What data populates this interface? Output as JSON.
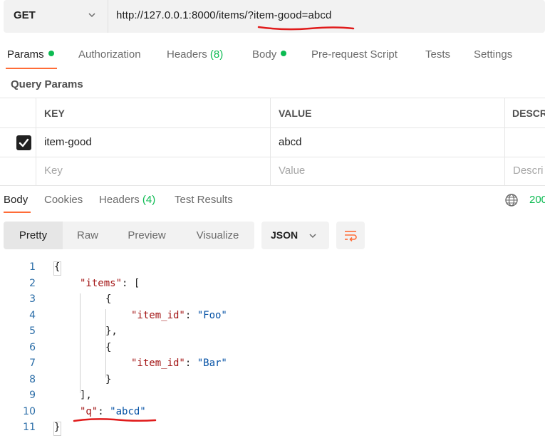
{
  "request": {
    "method": "GET",
    "url": "http://127.0.0.1:8000/items/?item-good=abcd"
  },
  "request_tabs": {
    "params": "Params",
    "authorization": "Authorization",
    "headers": "Headers",
    "headers_count": "(8)",
    "body": "Body",
    "prerequest": "Pre-request Script",
    "tests": "Tests",
    "settings": "Settings"
  },
  "query_params": {
    "title": "Query Params",
    "columns": {
      "key": "KEY",
      "value": "VALUE",
      "description": "DESCR"
    },
    "rows": [
      {
        "key": "item-good",
        "value": "abcd",
        "checked": true
      }
    ],
    "placeholders": {
      "key": "Key",
      "value": "Value",
      "description": "Descri"
    }
  },
  "response_tabs": {
    "body": "Body",
    "cookies": "Cookies",
    "headers": "Headers",
    "headers_count": "(4)",
    "test_results": "Test Results",
    "status": "200"
  },
  "view": {
    "modes": [
      "Pretty",
      "Raw",
      "Preview",
      "Visualize"
    ],
    "active_mode": "Pretty",
    "format": "JSON"
  },
  "code": {
    "line_numbers": [
      "1",
      "2",
      "3",
      "4",
      "5",
      "6",
      "7",
      "8",
      "9",
      "10",
      "11"
    ],
    "lines": [
      {
        "parts": [
          {
            "t": "{",
            "c": "p"
          }
        ]
      },
      {
        "parts": [
          {
            "t": "\"items\"",
            "c": "key"
          },
          {
            "t": ": [",
            "c": "p"
          }
        ]
      },
      {
        "parts": [
          {
            "t": "{",
            "c": "p"
          }
        ]
      },
      {
        "parts": [
          {
            "t": "\"item_id\"",
            "c": "key"
          },
          {
            "t": ": ",
            "c": "p"
          },
          {
            "t": "\"Foo\"",
            "c": "str"
          }
        ]
      },
      {
        "parts": [
          {
            "t": "},",
            "c": "p"
          }
        ]
      },
      {
        "parts": [
          {
            "t": "{",
            "c": "p"
          }
        ]
      },
      {
        "parts": [
          {
            "t": "\"item_id\"",
            "c": "key"
          },
          {
            "t": ": ",
            "c": "p"
          },
          {
            "t": "\"Bar\"",
            "c": "str"
          }
        ]
      },
      {
        "parts": [
          {
            "t": "}",
            "c": "p"
          }
        ]
      },
      {
        "parts": [
          {
            "t": "],",
            "c": "p"
          }
        ]
      },
      {
        "parts": [
          {
            "t": "\"q\"",
            "c": "key"
          },
          {
            "t": ": ",
            "c": "p"
          },
          {
            "t": "\"abcd\"",
            "c": "str"
          }
        ]
      },
      {
        "parts": [
          {
            "t": "}",
            "c": "p"
          }
        ]
      }
    ]
  },
  "colors": {
    "accent": "#ff6c37",
    "success": "#0cbb52",
    "annotation": "#e01b1b",
    "json_key": "#a31515",
    "json_string": "#0451a5"
  }
}
